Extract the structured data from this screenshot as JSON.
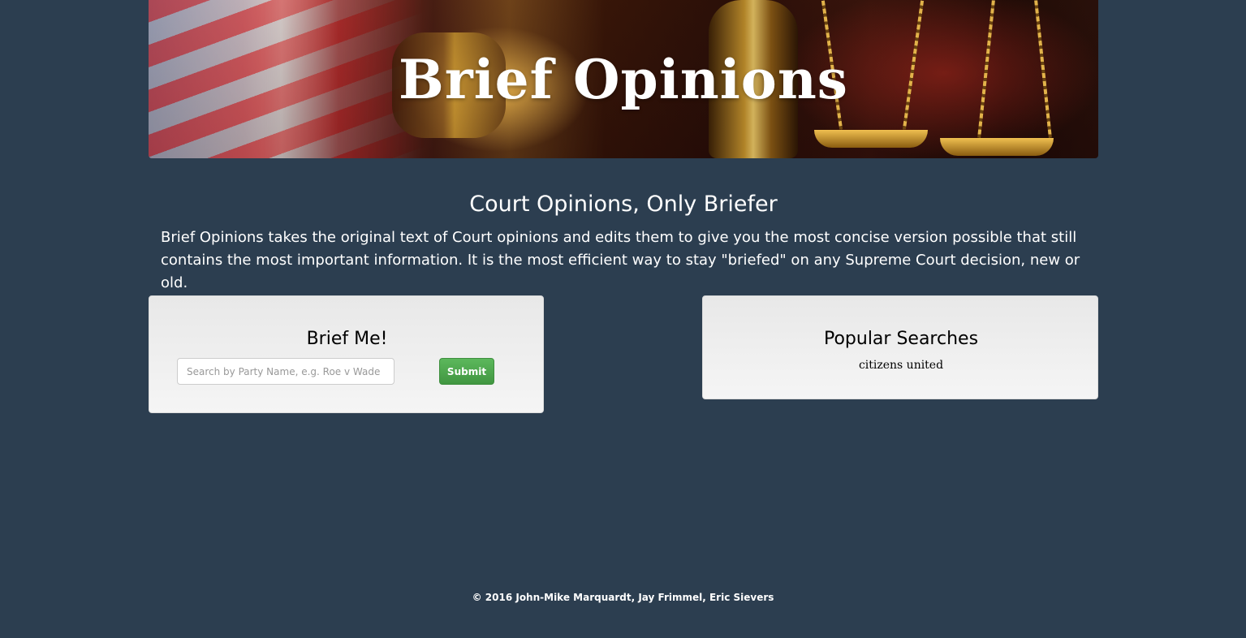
{
  "header": {
    "title": "Brief Opinions"
  },
  "intro": {
    "tagline": "Court Opinions, Only Briefer",
    "description": "Brief Opinions takes the original text of Court opinions and edits them to give you the most concise version possible that still contains the most important information. It is the most efficient way to stay \"briefed\" on any Supreme Court decision, new or old."
  },
  "search": {
    "heading": "Brief Me!",
    "placeholder": "Search by Party Name, e.g. Roe v Wade",
    "value": "",
    "submit_label": "Submit",
    "submit_color": "#5cb85c"
  },
  "popular": {
    "heading": "Popular Searches",
    "items": [
      "citizens united"
    ]
  },
  "footer": {
    "text": "© 2016 John-Mike Marquardt, Jay Frimmel, Eric Sievers"
  },
  "theme": {
    "background": "#2c3e50",
    "panel_background": "#f5f5f5"
  }
}
